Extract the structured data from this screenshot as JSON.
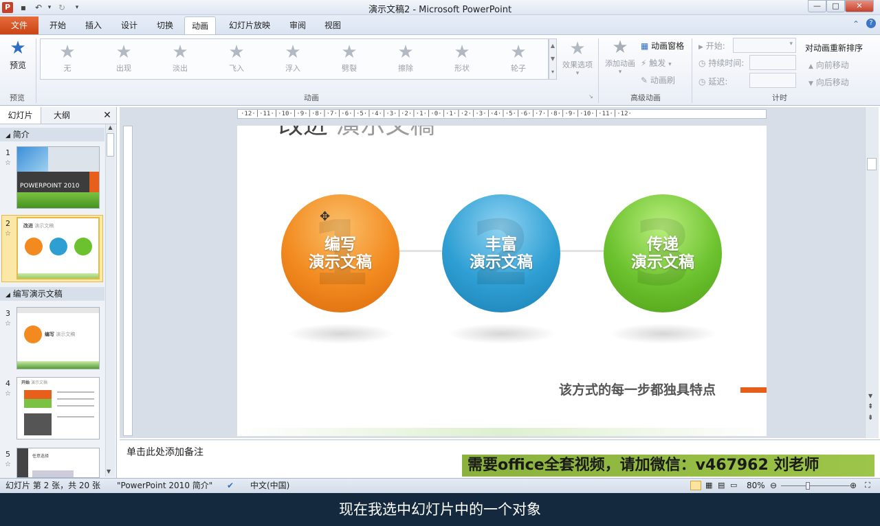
{
  "window": {
    "title": "演示文稿2 - Microsoft PowerPoint",
    "app_icon": "P",
    "minimize": "—",
    "maximize": "□",
    "close": "✕"
  },
  "tabs": {
    "file": "文件",
    "home": "开始",
    "insert": "插入",
    "design": "设计",
    "transitions": "切换",
    "animations": "动画",
    "slideshow": "幻灯片放映",
    "review": "审阅",
    "view": "视图"
  },
  "ribbon": {
    "preview": {
      "label": "预览",
      "group": "预览"
    },
    "gallery": {
      "group": "动画",
      "items": [
        {
          "label": "无"
        },
        {
          "label": "出现"
        },
        {
          "label": "淡出"
        },
        {
          "label": "飞入"
        },
        {
          "label": "浮入"
        },
        {
          "label": "劈裂"
        },
        {
          "label": "擦除"
        },
        {
          "label": "形状"
        },
        {
          "label": "轮子"
        }
      ]
    },
    "effect_options": "效果选项",
    "add_animation": "添加动画",
    "animation_pane": "动画窗格",
    "trigger": "触发",
    "painter": "动画刷",
    "advanced_group": "高级动画",
    "start": "开始:",
    "duration": "持续时间:",
    "delay": "延迟:",
    "reorder": "对动画重新排序",
    "move_earlier": "向前移动",
    "move_later": "向后移动",
    "timing_group": "计时"
  },
  "panel": {
    "tab_slides": "幻灯片",
    "tab_outline": "大纲",
    "close": "✕",
    "section1": "简介",
    "section2": "编写演示文稿",
    "slides": [
      {
        "num": "1",
        "caption": "POWERPOINT 2010"
      },
      {
        "num": "2",
        "title": "改进",
        "sub": "演示文稿"
      },
      {
        "num": "3",
        "title": "编写",
        "sub": "演示文稿"
      },
      {
        "num": "4",
        "title": "开始",
        "sub": "演示文稿"
      },
      {
        "num": "5",
        "title": "任意选择"
      }
    ]
  },
  "ruler_h": "·12·│·11·│·10·│·9·│·8·│·7·│·6·│·5·│·4·│·3·│·2·│·1·│·0·│·1·│·2·│·3·│·4·│·5·│·6·│·7·│·8·│·9·│·10·│·11·│·12·",
  "slide": {
    "title_main": "改进",
    "title_sub": "演示文稿",
    "circles": [
      {
        "num": "1",
        "line1": "编写",
        "line2": "演示文稿",
        "color": "#f28a1f"
      },
      {
        "num": "2",
        "line1": "丰富",
        "line2": "演示文稿",
        "color": "#2f9fd3"
      },
      {
        "num": "3",
        "line1": "传递",
        "line2": "演示文稿",
        "color": "#6cc22e"
      }
    ],
    "feature_text": "该方式的每一步都独具特点"
  },
  "notes": {
    "placeholder": "单击此处添加备注"
  },
  "watermark": "需要office全套视频，请加微信：v467962 刘老师",
  "status": {
    "slide_info": "幻灯片 第 2 张，共 20 张",
    "theme": "\"PowerPoint 2010 简介\"",
    "language": "中文(中国)",
    "zoom": "80%"
  },
  "caption": "现在我选中幻灯片中的一个对象"
}
